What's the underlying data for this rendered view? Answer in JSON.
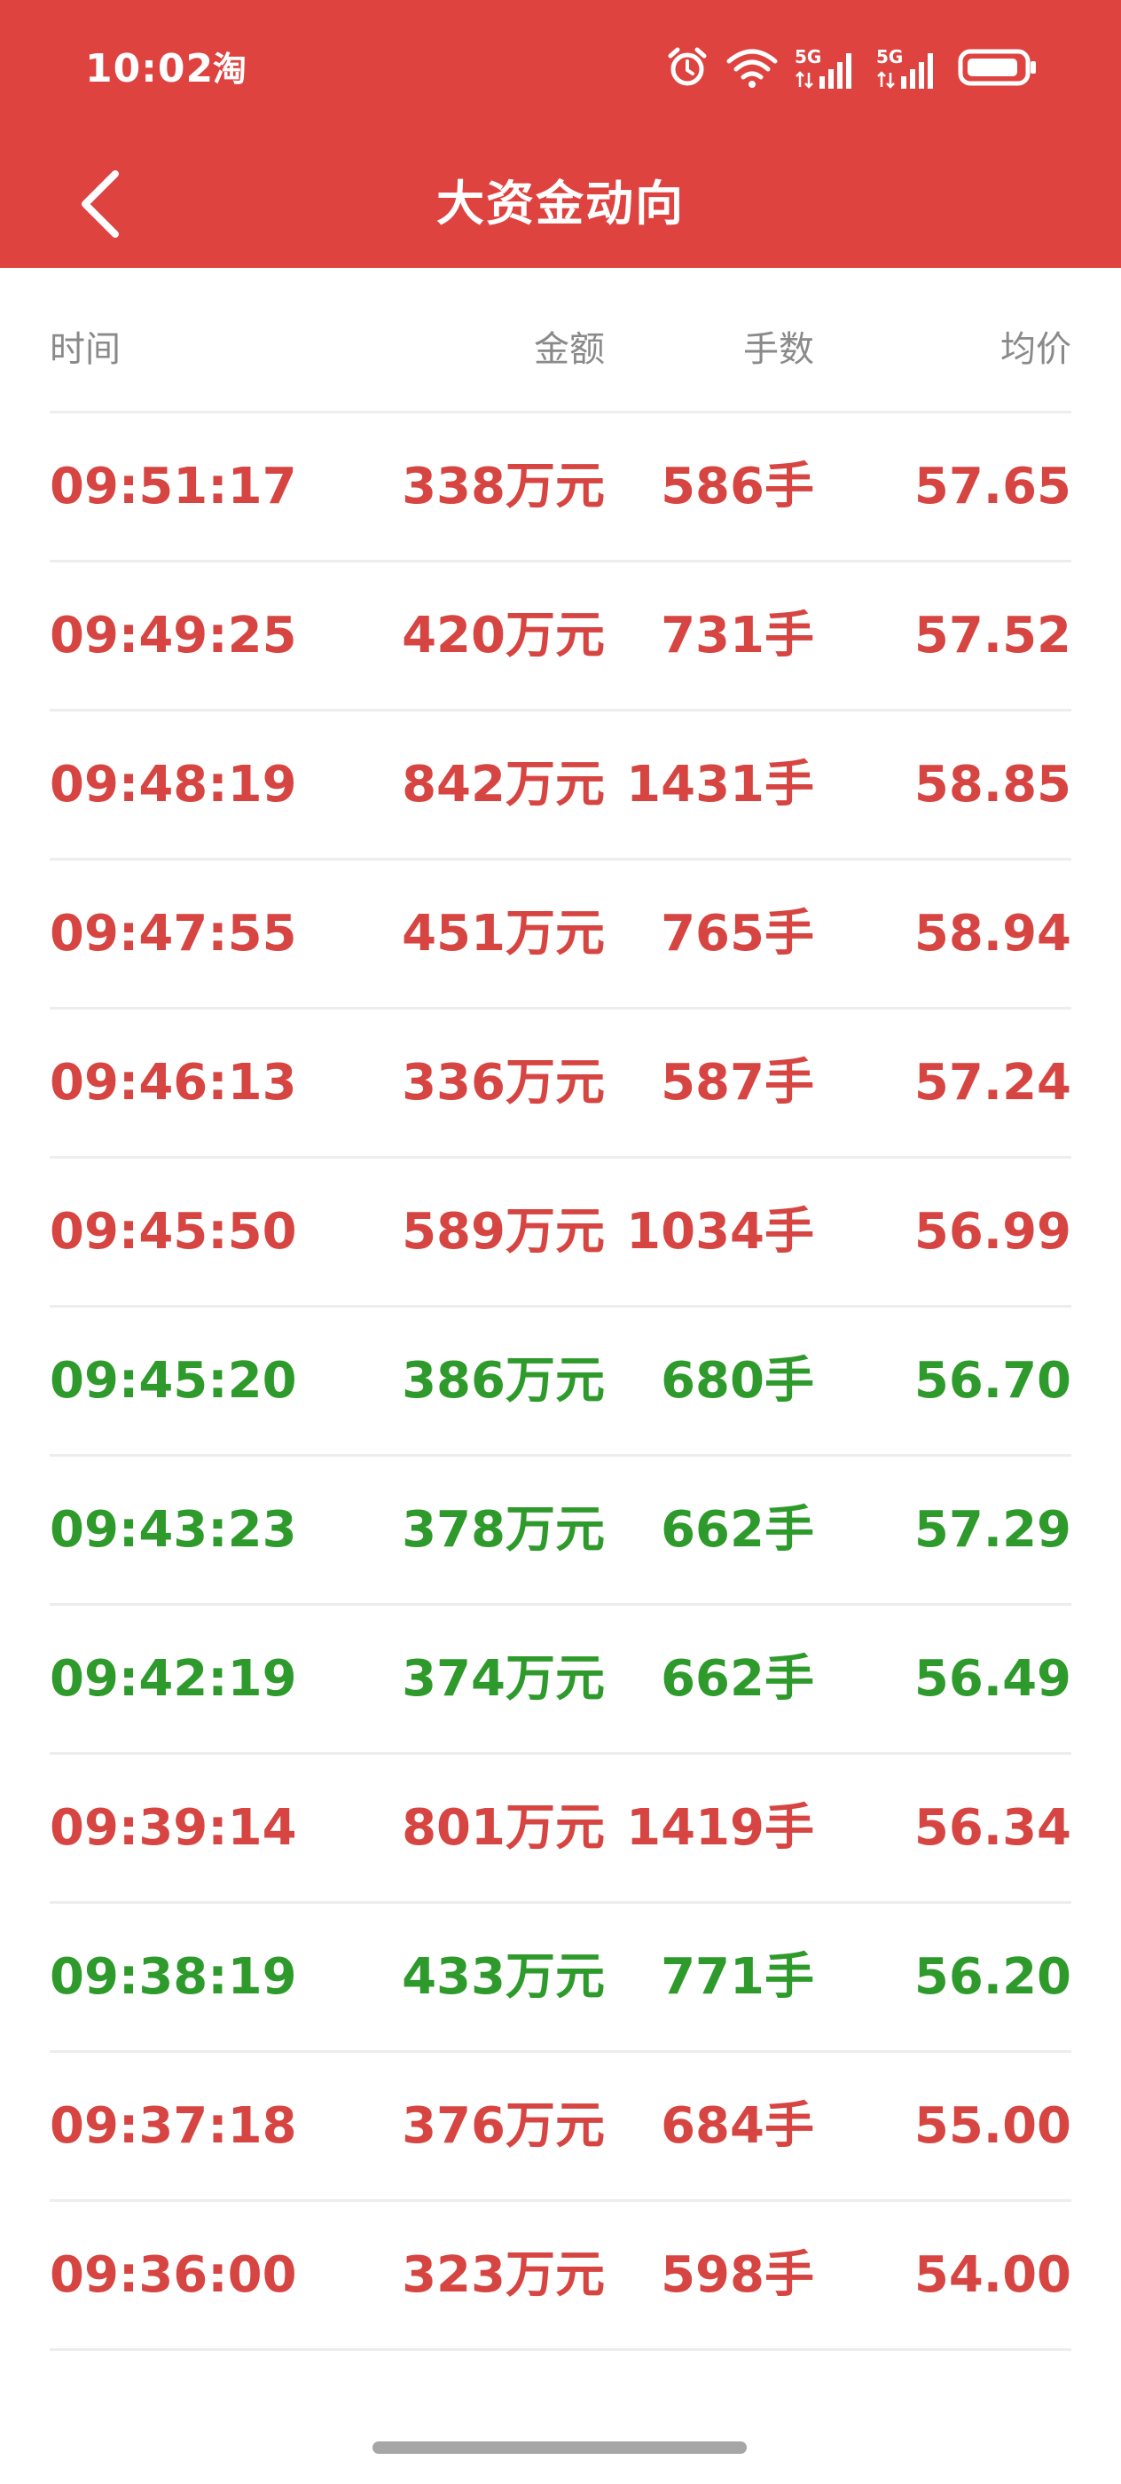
{
  "status_bar": {
    "time": "10:02",
    "app_icon": "淘",
    "signal_1_label": "5G",
    "signal_2_label": "5G"
  },
  "header": {
    "title": "大资金动向"
  },
  "table": {
    "columns": [
      "时间",
      "金额",
      "手数",
      "均价"
    ],
    "rows": [
      {
        "time": "09:51:17",
        "amount": "338万元",
        "lots": "586手",
        "avg": "57.65",
        "color": "red"
      },
      {
        "time": "09:49:25",
        "amount": "420万元",
        "lots": "731手",
        "avg": "57.52",
        "color": "red"
      },
      {
        "time": "09:48:19",
        "amount": "842万元",
        "lots": "1431手",
        "avg": "58.85",
        "color": "red"
      },
      {
        "time": "09:47:55",
        "amount": "451万元",
        "lots": "765手",
        "avg": "58.94",
        "color": "red"
      },
      {
        "time": "09:46:13",
        "amount": "336万元",
        "lots": "587手",
        "avg": "57.24",
        "color": "red"
      },
      {
        "time": "09:45:50",
        "amount": "589万元",
        "lots": "1034手",
        "avg": "56.99",
        "color": "red"
      },
      {
        "time": "09:45:20",
        "amount": "386万元",
        "lots": "680手",
        "avg": "56.70",
        "color": "green"
      },
      {
        "time": "09:43:23",
        "amount": "378万元",
        "lots": "662手",
        "avg": "57.29",
        "color": "green"
      },
      {
        "time": "09:42:19",
        "amount": "374万元",
        "lots": "662手",
        "avg": "56.49",
        "color": "green"
      },
      {
        "time": "09:39:14",
        "amount": "801万元",
        "lots": "1419手",
        "avg": "56.34",
        "color": "red"
      },
      {
        "time": "09:38:19",
        "amount": "433万元",
        "lots": "771手",
        "avg": "56.20",
        "color": "green"
      },
      {
        "time": "09:37:18",
        "amount": "376万元",
        "lots": "684手",
        "avg": "55.00",
        "color": "red"
      },
      {
        "time": "09:36:00",
        "amount": "323万元",
        "lots": "598手",
        "avg": "54.00",
        "color": "red"
      }
    ]
  },
  "colors": {
    "header_bg": "#de4340",
    "up_red": "#d64541",
    "down_green": "#2f9a2c",
    "header_text_gray": "#8a8a8a"
  }
}
